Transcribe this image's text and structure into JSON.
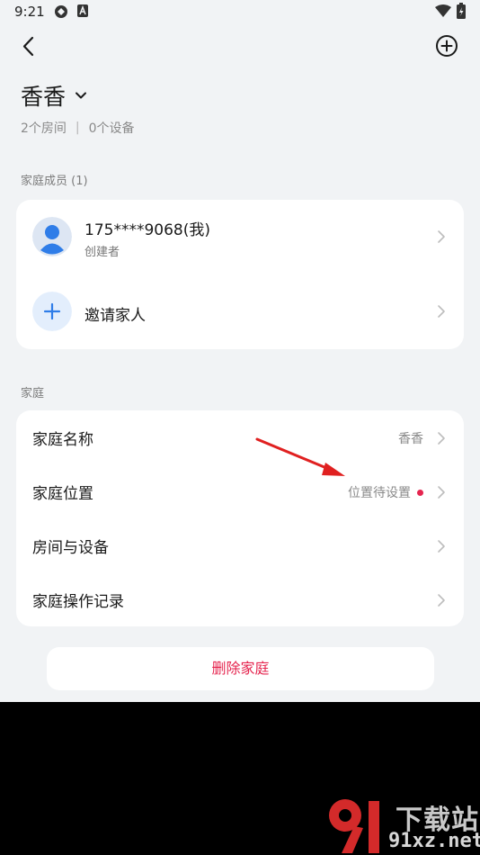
{
  "status_bar": {
    "time": "9:21"
  },
  "home": {
    "name": "香香",
    "rooms": "2个房间",
    "separator": "|",
    "devices": "0个设备"
  },
  "members_section": {
    "label": "家庭成员 (1)",
    "members": [
      {
        "name": "175****9068(我)",
        "role": "创建者"
      }
    ],
    "invite_label": "邀请家人"
  },
  "home_section": {
    "label": "家庭",
    "rows": [
      {
        "label": "家庭名称",
        "value": "香香"
      },
      {
        "label": "家庭位置",
        "value": "位置待设置"
      },
      {
        "label": "房间与设备",
        "value": ""
      },
      {
        "label": "家庭操作记录",
        "value": ""
      }
    ]
  },
  "delete_button": "删除家庭",
  "watermark": {
    "top": "下载站",
    "bottom": "91xz.net"
  },
  "colors": {
    "accent_red": "#e5254f",
    "avatar_blue": "#2f7de8",
    "background": "#f1f3f5"
  }
}
